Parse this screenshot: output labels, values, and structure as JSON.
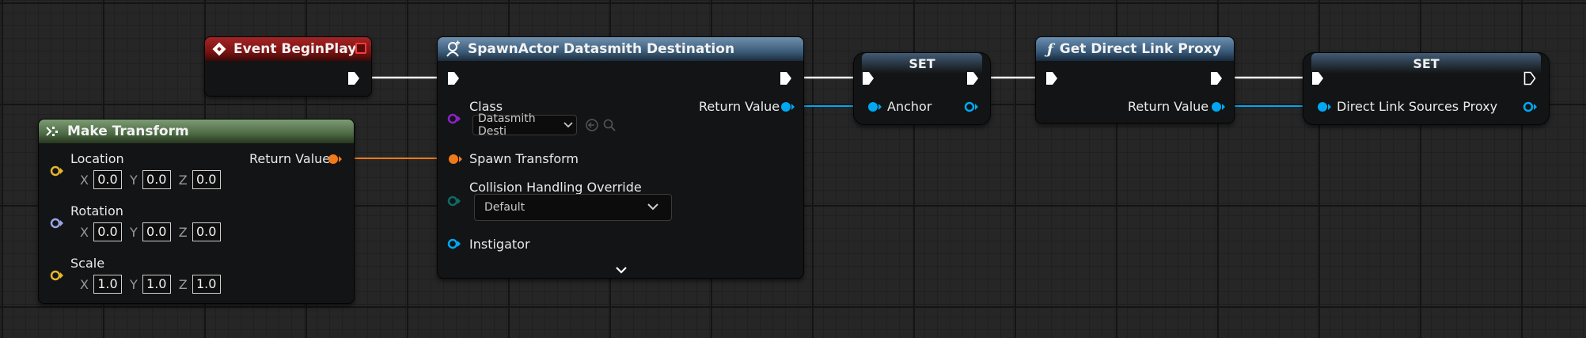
{
  "event_begin_play": {
    "title": "Event BeginPlay"
  },
  "make_transform": {
    "title": "Make Transform",
    "location_label": "Location",
    "rotation_label": "Rotation",
    "scale_label": "Scale",
    "return_value": "Return Value",
    "axis_x": "X",
    "axis_y": "Y",
    "axis_z": "Z",
    "location": [
      "0.0",
      "0.0",
      "0.0"
    ],
    "rotation": [
      "0.0",
      "0.0",
      "0.0"
    ],
    "scale": [
      "1.0",
      "1.0",
      "1.0"
    ]
  },
  "spawn_actor": {
    "title": "SpawnActor Datasmith Destination",
    "class_label": "Class",
    "class_value": "Datasmith Desti",
    "return_value": "Return Value",
    "spawn_transform": "Spawn Transform",
    "collision_label": "Collision Handling Override",
    "collision_value": "Default",
    "instigator": "Instigator"
  },
  "set_anchor": {
    "title": "SET",
    "pin": "Anchor"
  },
  "get_direct_link_proxy": {
    "title": "Get Direct Link Proxy",
    "return_value": "Return Value"
  },
  "set_direct_link": {
    "title": "SET",
    "pin": "Direct Link Sources Proxy"
  },
  "icons": {
    "event": "event-diamond-icon",
    "make": "make-struct-icon",
    "spawn": "spawn-actor-icon",
    "function": "function-icon"
  },
  "colors": {
    "exec": "#ffffff",
    "object_pin": "#00a8f2",
    "struct_transform": "#f07a1a",
    "vector": "#e6b62c",
    "rotator": "#9aa4e6",
    "class_pin": "#8a22c8",
    "enum_pin": "#0f6b65"
  }
}
